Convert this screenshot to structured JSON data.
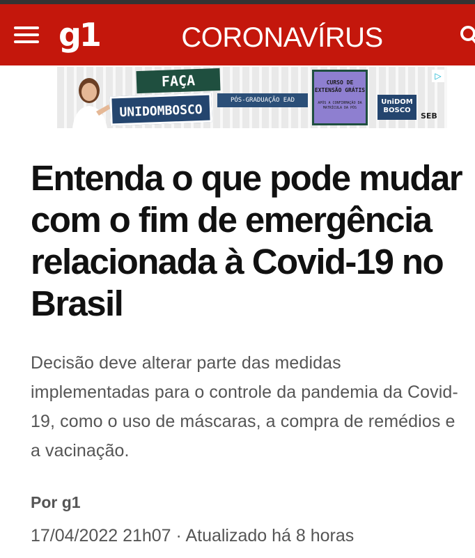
{
  "header": {
    "logo": "g1",
    "section_title": "CORONAVÍRUS",
    "menu_icon": "hamburger-menu-icon",
    "search_icon": "search-icon",
    "background_color": "#c4170c"
  },
  "ad": {
    "bubble_text": "FAÇA",
    "brand_text": "UNIDOMBOSCO",
    "tagline": "PÓS-GRADUAÇÃO EAD",
    "card_title": "CURSO DE EXTENSÃO GRÁTIS",
    "card_subtitle": "APÓS A CONFIRMAÇÃO DA MATRÍCULA DA PÓS",
    "logo_text": "UniDOM BOSCO",
    "group_text": "SEB",
    "adchoices_icon": "adchoices-icon"
  },
  "article": {
    "headline": "Entenda o que pode mudar com o fim de emergência relacionada à Covid-19 no Brasil",
    "subtitle": "Decisão deve alterar parte das medidas implementadas para o controle da pandemia da Covid-19, como o uso de máscaras, a compra de remédios e a vacinação.",
    "byline": "Por g1",
    "published": "17/04/2022 21h07",
    "separator": "·",
    "updated": "Atualizado há 8 horas"
  }
}
